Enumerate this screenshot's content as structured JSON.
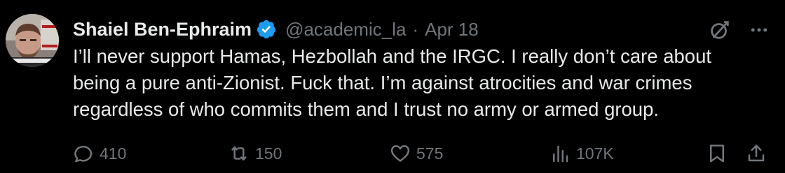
{
  "tweet": {
    "author": {
      "display_name": "Shaiel Ben-Ephraim",
      "handle": "@academic_la",
      "verified": true
    },
    "separator": "·",
    "date": "Apr 18",
    "text_lines": [
      "I’ll never support Hamas, Hezbollah and the IRGC. I really don’t care about",
      "being a pure anti-Zionist. Fuck that. I’m against atrocities and war crimes",
      "regardless of who commits them and I trust no army or armed group."
    ],
    "stats": {
      "replies": "410",
      "reposts": "150",
      "likes": "575",
      "views": "107K"
    }
  },
  "icons": {
    "verified": "verified-badge-icon",
    "grok": "grok-icon",
    "more": "more-icon",
    "reply": "reply-icon",
    "repost": "repost-icon",
    "like": "heart-icon",
    "views": "views-chart-icon",
    "bookmark": "bookmark-icon",
    "share": "share-icon"
  },
  "colors": {
    "background": "#000000",
    "primary_text": "#e7e9ea",
    "secondary_text": "#71767b",
    "verified_blue": "#1d9bf0"
  }
}
